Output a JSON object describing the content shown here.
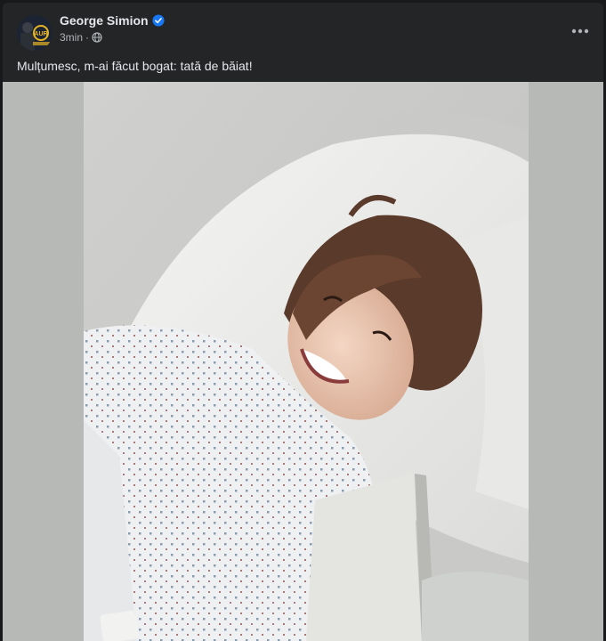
{
  "post": {
    "author": "George Simion",
    "time": "3min",
    "separator": "·",
    "privacy_icon": "globe-icon",
    "verified_icon": "verified-badge-icon",
    "menu_icon": "more-horizontal-icon",
    "caption": "Mulțumesc, m-ai făcut bogat: tată de băiat!",
    "avatar_badge": "AUR"
  },
  "colors": {
    "background": "#18191a",
    "card": "#242526",
    "text_primary": "#e4e6eb",
    "text_secondary": "#b0b3b8",
    "verified_blue": "#1877f2",
    "badge_gold": "#e6b422"
  }
}
